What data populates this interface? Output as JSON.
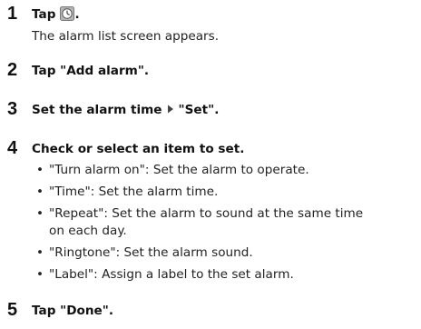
{
  "steps": [
    {
      "number": "1",
      "title_prefix": "Tap",
      "title_suffix": ".",
      "icon": "clock-app-icon",
      "description": "The alarm list screen appears."
    },
    {
      "number": "2",
      "title": "Tap \"Add alarm\"."
    },
    {
      "number": "3",
      "title_prefix": "Set the alarm time",
      "title_suffix": "\"Set\".",
      "separator_icon": "right-triangle-arrow-icon"
    },
    {
      "number": "4",
      "title": "Check or select an item to set.",
      "bullets": [
        "\"Turn alarm on\": Set the alarm to operate.",
        "\"Time\": Set the alarm time.",
        "\"Repeat\": Set the alarm to sound at the same time",
        "\"Ringtone\": Set the alarm sound.",
        "\"Label\": Assign a label to the set alarm."
      ],
      "bullet_continuation": "on each day."
    },
    {
      "number": "5",
      "title": "Tap \"Done\"."
    }
  ],
  "bullet_char": "•"
}
